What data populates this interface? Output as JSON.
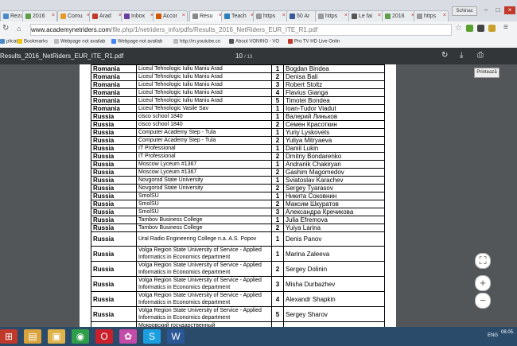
{
  "browser": {
    "tabs": [
      {
        "label": "Rezultatele",
        "color": "#4a8ac9"
      },
      {
        "label": "2016",
        "color": "#5e9e4a"
      },
      {
        "label": "Comu",
        "color": "#e69a2b"
      },
      {
        "label": "Arad",
        "color": "#c0392b"
      },
      {
        "label": "Inbox",
        "color": "#6b3fa0"
      },
      {
        "label": "Accor",
        "color": "#d35400"
      },
      {
        "label": "Resu",
        "color": "#888888"
      },
      {
        "label": "Teach",
        "color": "#2c7fb8"
      },
      {
        "label": "https",
        "color": "#999999"
      },
      {
        "label": "50 Ar",
        "color": "#3b5998"
      },
      {
        "label": "https",
        "color": "#999999"
      },
      {
        "label": "Le fai",
        "color": "#555555"
      },
      {
        "label": "2016",
        "color": "#5e9e4a"
      },
      {
        "label": "https",
        "color": "#999999"
      }
    ],
    "login_label": "Schinac",
    "url_domain": "www.academynetriders.com",
    "url_path": "/file.php/1/netriders_info/pdfs/Results_2016_NetRiders_EUR_ITE_R1.pdf",
    "bookmarks": [
      {
        "label": "plicati",
        "color": "#4a8ac9"
      },
      {
        "label": "Bookmarks",
        "color": "#f1c40f"
      },
      {
        "label": "Webpage not availab",
        "color": "#bbbbbb"
      },
      {
        "label": "Webpage not availab",
        "color": "#4285f4"
      },
      {
        "label": "http://m.youtube.co",
        "color": "#bbbbbb"
      },
      {
        "label": "About VONINO - VO",
        "color": "#555555"
      },
      {
        "label": "Pro TV HD Live Onlin",
        "color": "#c0392b"
      }
    ]
  },
  "pdf": {
    "filename": "Results_2016_NetRiders_EUR_ITE_R1.pdf",
    "page_current": "10",
    "page_total": "13",
    "tooltip": "Printează"
  },
  "table": [
    {
      "country": "Romania",
      "school": "Liceul Tehnologic Iuliu Maniu Arad",
      "rank": "1",
      "name": "Bogdan Bindea"
    },
    {
      "country": "Romania",
      "school": "Liceul Tehnologic Iuliu Maniu Arad",
      "rank": "2",
      "name": "Denisa Bali"
    },
    {
      "country": "Romania",
      "school": "Liceul Tehnologic Iuliu Maniu Arad",
      "rank": "3",
      "name": "Robert Stoltz"
    },
    {
      "country": "Romania",
      "school": "Liceul Tehnologic Iuliu Maniu Arad",
      "rank": "4",
      "name": "Flavius Gianga"
    },
    {
      "country": "Romania",
      "school": "Liceul Tehnologic Iuliu Maniu Arad",
      "rank": "5",
      "name": "Timotei Bondea"
    },
    {
      "country": "Romania",
      "school": "Liceul Tehnologic Vasile Sav",
      "rank": "1",
      "name": "Ioan-Tudor Viadut"
    },
    {
      "country": "Russia",
      "school": "cisco school 1840",
      "rank": "1",
      "name": "Валерий Линьков"
    },
    {
      "country": "Russia",
      "school": "cisco school 1840",
      "rank": "2",
      "name": "Семен Красоткин"
    },
    {
      "country": "Russia",
      "school": "Computer Academy Step - Tula",
      "rank": "1",
      "name": "Yuriy Lyskovets"
    },
    {
      "country": "Russia",
      "school": "Computer Academy Step - Tula",
      "rank": "2",
      "name": "Yuliya Mitryaeva"
    },
    {
      "country": "Russia",
      "school": "IT Professional",
      "rank": "1",
      "name": "Daniil Lukin"
    },
    {
      "country": "Russia",
      "school": "IT Professional",
      "rank": "2",
      "name": "Dmitriy Bondarenko"
    },
    {
      "country": "Russia",
      "school": "Moscow Lyceum #1367",
      "rank": "1",
      "name": "Andranik Chakiryan"
    },
    {
      "country": "Russia",
      "school": "Moscow Lyceum #1367",
      "rank": "2",
      "name": "Gashim Magomedov"
    },
    {
      "country": "Russia",
      "school": "Novgorod State University",
      "rank": "1",
      "name": "Sviatoslav Karachev"
    },
    {
      "country": "Russia",
      "school": "Novgorod State University",
      "rank": "2",
      "name": "Sergey Tyarasov"
    },
    {
      "country": "Russia",
      "school": "SmolSU",
      "rank": "1",
      "name": "Никита Соковнин"
    },
    {
      "country": "Russia",
      "school": "SmolSU",
      "rank": "2",
      "name": "Максим Шкуратов"
    },
    {
      "country": "Russia",
      "school": "SmolSU",
      "rank": "3",
      "name": "Александра Кречикова"
    },
    {
      "country": "Russia",
      "school": "Tambov Business College",
      "rank": "1",
      "name": "Julia Efremova"
    },
    {
      "country": "Russia",
      "school": "Tambov Business College",
      "rank": "2",
      "name": "Yuiya Larina"
    },
    {
      "country": "Russia",
      "school": "Ural Radio Engineering College n.a. A.S. Popov",
      "rank": "1",
      "name": "Denis Panov",
      "tall": true
    },
    {
      "country": "Russia",
      "school": "Volga Region State University of Service - Applied Informatics in Economics department",
      "rank": "1",
      "name": "Marina Zaleeva",
      "tall": true
    },
    {
      "country": "Russia",
      "school": "Volga Region State University of Service - Applied Informatics in Economics department",
      "rank": "2",
      "name": "Sergey Dolinin",
      "tall": true
    },
    {
      "country": "Russia",
      "school": "Volga Region State University of Service - Applied Informatics in Economics department",
      "rank": "3",
      "name": "Misha Durbazhev",
      "tall": true
    },
    {
      "country": "Russia",
      "school": "Volga Region State University of Service - Applied Informatics in Economics department",
      "rank": "4",
      "name": "Alexandr Shapkin",
      "tall": true
    },
    {
      "country": "Russia",
      "school": "Volga Region State University of Service - Applied Informatics in Economics department",
      "rank": "5",
      "name": "Sergey Sharov",
      "tall": true
    },
    {
      "country": "",
      "school": "Мокровский государственный",
      "rank": "",
      "name": ""
    }
  ],
  "taskbar": {
    "buttons": [
      {
        "name": "file-explorer",
        "glyph": "▤",
        "color": "#d9a23c"
      },
      {
        "name": "folder",
        "glyph": "▣",
        "color": "#e0b24a"
      },
      {
        "name": "chrome",
        "glyph": "◉",
        "color": "#2e9e49"
      },
      {
        "name": "opera",
        "glyph": "O",
        "color": "#cc1f2c"
      },
      {
        "name": "app-pink",
        "glyph": "✿",
        "color": "#c44ba8"
      },
      {
        "name": "skype",
        "glyph": "S",
        "color": "#1b9fe0"
      },
      {
        "name": "word",
        "glyph": "W",
        "color": "#2b5797"
      }
    ],
    "lang": "ENG",
    "date": "08.05."
  }
}
